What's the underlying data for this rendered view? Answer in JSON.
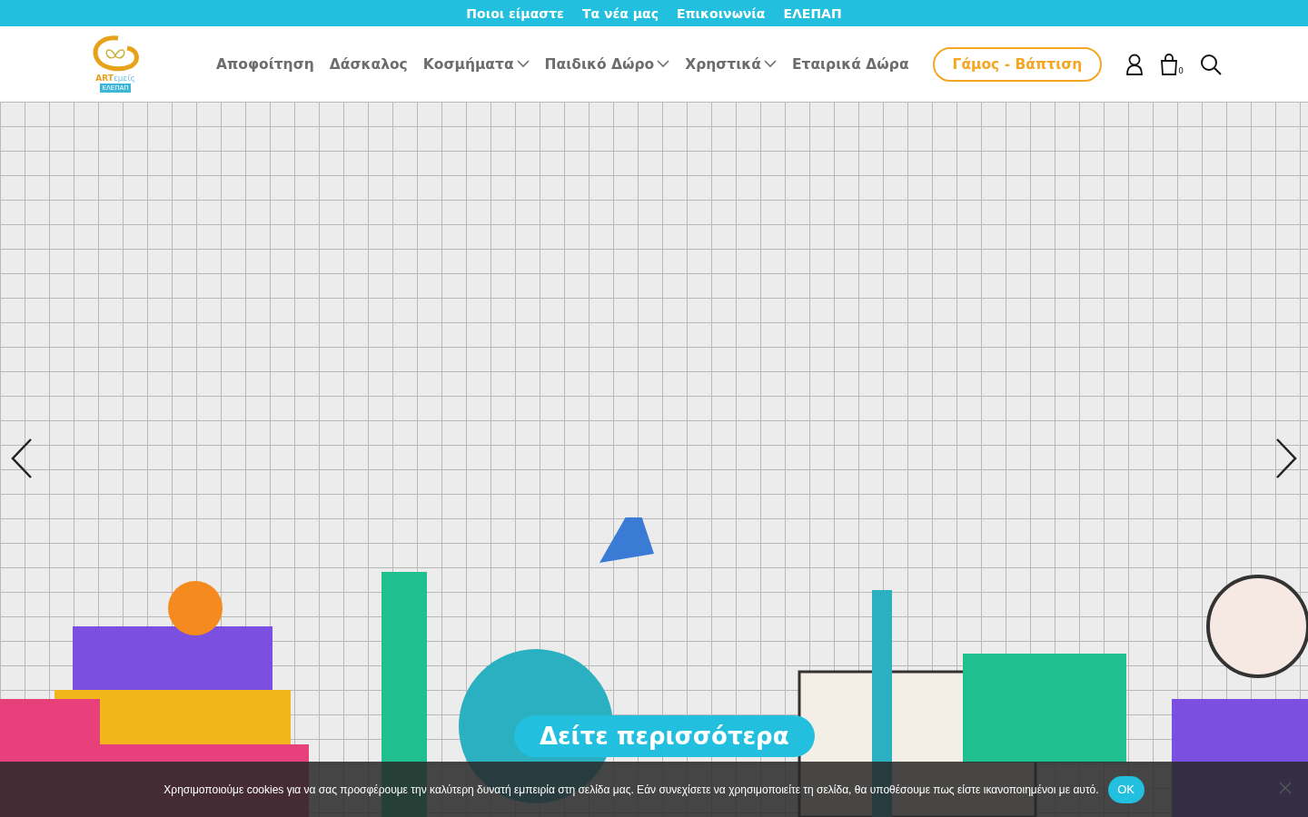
{
  "top_bar": {
    "links": [
      "Ποιοι είμαστε",
      "Τα νέα μας",
      "Επικοινωνία",
      "ΕΛΕΠΑΠ"
    ]
  },
  "logo": {
    "name_part1": "ART",
    "name_part2": "εμείς",
    "badge": "ΕΛΕΠΑΠ"
  },
  "nav": {
    "items": [
      {
        "label": "Αποφοίτηση",
        "has_menu": false
      },
      {
        "label": "Δάσκαλος",
        "has_menu": false
      },
      {
        "label": "Κοσμήματα",
        "has_menu": true
      },
      {
        "label": "Παιδικό Δώρο",
        "has_menu": true
      },
      {
        "label": "Χρηστικά",
        "has_menu": true
      },
      {
        "label": "Εταιρικά Δώρα",
        "has_menu": false
      }
    ],
    "cta": "Γάμος - Βάπτιση",
    "cart_count": "0"
  },
  "hero": {
    "button": "Δείτε περισσότερα"
  },
  "cookie_bar": {
    "text": "Χρησιμοποιούμε cookies για να σας προσφέρουμε την καλύτερη δυνατή εμπειρία στη σελίδα μας. Εάν συνεχίσετε να χρησιμοποιείτε τη σελίδα, θα υποθέσουμε πως είστε ικανοποιημένοι με αυτό.",
    "ok": "OK"
  }
}
